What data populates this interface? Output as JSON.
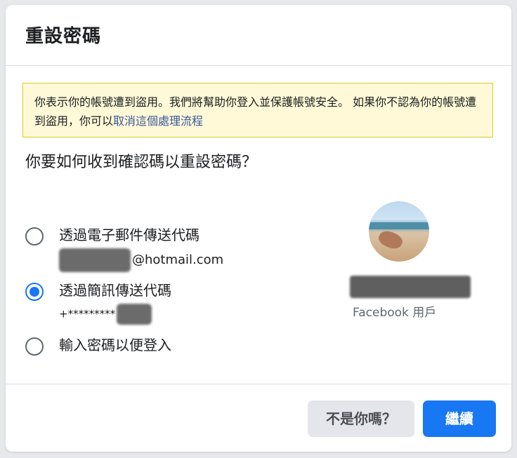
{
  "dialog": {
    "title": "重設密碼"
  },
  "notice": {
    "text": "你表示你的帳號遭到盜用。我們將幫助你登入並保護帳號安全。 如果你不認為你的帳號遭到盜用，你可以",
    "link": "取消這個處理流程"
  },
  "question": "你要如何收到確認碼以重設密碼？",
  "options": [
    {
      "label": "透過電子郵件傳送代碼",
      "detail": "@hotmail.com",
      "selected": false
    },
    {
      "label": "透過簡訊傳送代碼",
      "detail": "+*********",
      "selected": true
    },
    {
      "label": "輸入密碼以便登入",
      "detail": "",
      "selected": false
    }
  ],
  "profile": {
    "account_type": "Facebook 用戶"
  },
  "footer": {
    "not_you_label": "不是你嗎？",
    "continue_label": "繼續"
  },
  "colors": {
    "primary": "#1877f2",
    "notice_bg": "#fff9d7",
    "notice_border": "#e2c822",
    "link": "#385898"
  }
}
